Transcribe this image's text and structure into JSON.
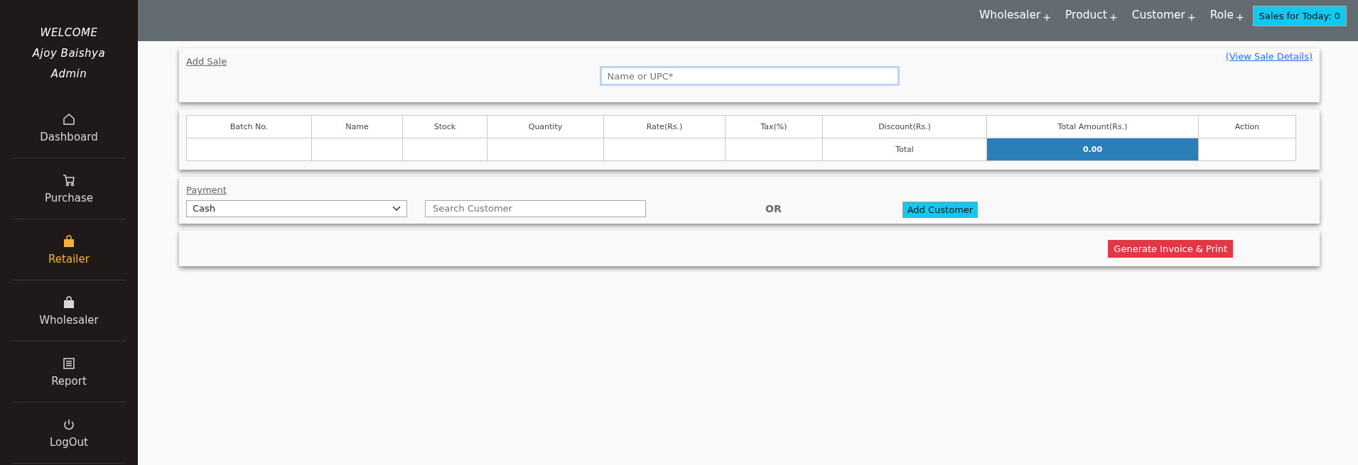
{
  "sidebar": {
    "welcome": [
      "WELCOME",
      "Ajoy Baishya",
      "Admin"
    ],
    "items": [
      {
        "label": "Dashboard",
        "kind": "home",
        "selected": false
      },
      {
        "label": "Purchase",
        "kind": "cart",
        "selected": false
      },
      {
        "label": "Retailer",
        "kind": "bag",
        "selected": true
      },
      {
        "label": "Wholesaler",
        "kind": "bag",
        "selected": false
      },
      {
        "label": "Report",
        "kind": "report",
        "selected": false
      },
      {
        "label": "LogOut",
        "kind": "power",
        "selected": false
      }
    ]
  },
  "top_nav": {
    "items": [
      {
        "label": "Wholesaler",
        "marker": "+"
      },
      {
        "label": "Product",
        "marker": "+"
      },
      {
        "label": "Customer",
        "marker": "+"
      },
      {
        "label": "Role",
        "marker": "+"
      }
    ],
    "sales_badge": "Sales for Today: 0"
  },
  "add_sale": {
    "title": "Add Sale",
    "search": {
      "placeholder": "Name or UPC*"
    },
    "details_link": "(View Sale Details)"
  },
  "table": {
    "columns": [
      "Batch No.",
      "Name",
      "Stock",
      "Quantity",
      "Rate(Rs.)",
      "Tax(%)",
      "Discount(Rs.)",
      "Total Amount(Rs.)",
      "Action"
    ],
    "total_row": {
      "label": "Total",
      "amount": "0.00"
    }
  },
  "payment": {
    "title": "Payment",
    "method": {
      "value": "Cash"
    },
    "customer_search": {
      "placeholder": "Search Customer"
    },
    "or_text": "OR",
    "add_button": "Add Customer"
  },
  "actions": {
    "generate_button": "Generate Invoice & Print"
  }
}
